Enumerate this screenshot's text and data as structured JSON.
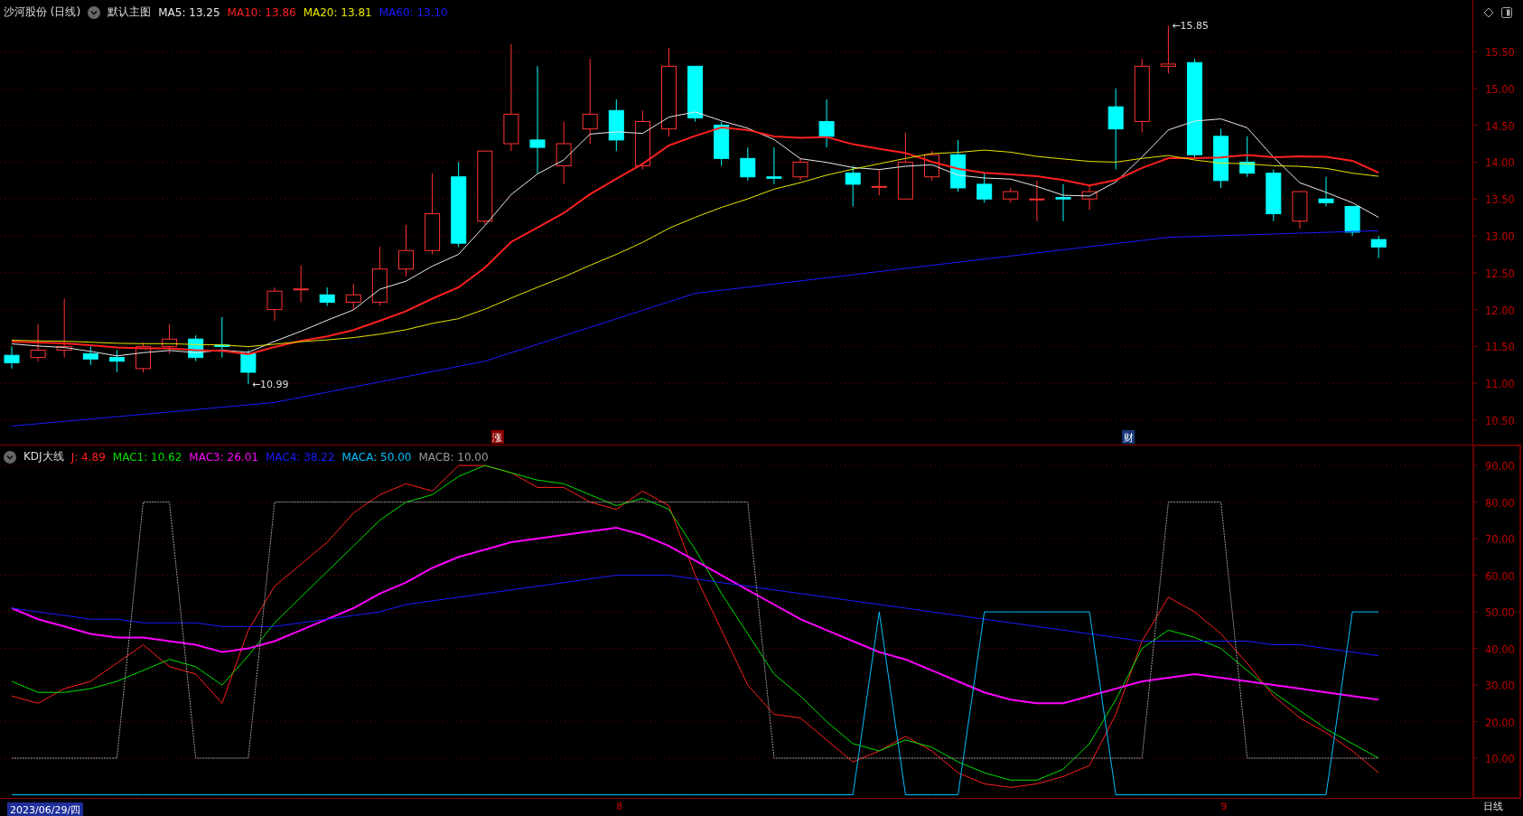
{
  "price_panel": {
    "title": "沙河股份 (日线)",
    "template": "默认主图",
    "legend": [
      {
        "label": "MA5: 13.25",
        "color": "#e8e8e8"
      },
      {
        "label": "MA10: 13.86",
        "color": "#ff2020"
      },
      {
        "label": "MA20: 13.81",
        "color": "#e6e600"
      },
      {
        "label": "MA60: 13.10",
        "color": "#1a1aff"
      }
    ],
    "annotations": [
      {
        "text": "←10.99"
      },
      {
        "text": "←15.85"
      }
    ],
    "markers": [
      {
        "text": "涨",
        "color": "#8b0000"
      },
      {
        "text": "财",
        "color": "#1a3a7a"
      }
    ],
    "yticks": [
      "15.50",
      "15.00",
      "14.50",
      "14.00",
      "13.50",
      "13.00",
      "12.50",
      "12.00",
      "11.50",
      "11.00",
      "10.50"
    ]
  },
  "indicator_panel": {
    "title": "KDJ大线",
    "legend": [
      {
        "value": "4.89"
      },
      {
        "value": "10.62"
      },
      {
        "value": "26.01"
      },
      {
        "value": "38.22"
      },
      {
        "value": "50.00"
      },
      {
        "value": "10.00"
      }
    ],
    "chart_data": {
      "type": "line",
      "grid": true,
      "ylim": [
        -1.1,
        95.7
      ],
      "yticks": [
        {
          "value": 90,
          "label": "90.00"
        },
        {
          "value": 80,
          "label": "80.00"
        },
        {
          "value": 70,
          "label": "70.00"
        },
        {
          "value": 60,
          "label": "60.00"
        },
        {
          "value": 50,
          "label": "50.00"
        },
        {
          "value": 40,
          "label": "40.00"
        },
        {
          "value": 30,
          "label": "30.00"
        },
        {
          "value": 20,
          "label": "20.00"
        },
        {
          "value": 10,
          "label": "10.00"
        }
      ],
      "series": [
        {
          "name": "J:",
          "color": "#ff2020",
          "values": [
            27,
            25,
            29,
            31,
            36,
            41,
            35,
            33,
            25,
            45,
            57,
            63,
            69,
            77,
            82,
            85,
            83,
            90,
            90,
            88,
            84,
            84,
            80,
            78,
            83,
            79,
            60,
            45,
            30,
            22,
            21,
            15,
            9,
            12,
            16,
            12,
            6,
            3,
            2,
            3,
            5,
            8,
            22,
            42,
            54,
            50,
            44,
            36,
            27,
            21,
            17,
            12,
            6
          ]
        },
        {
          "name": "MAC1:",
          "color": "#00e000",
          "values": [
            31,
            28,
            28,
            29,
            31,
            34,
            37,
            35,
            30,
            38,
            47,
            54,
            61,
            68,
            75,
            80,
            82,
            87,
            90,
            88,
            86,
            85,
            82,
            79,
            81,
            78,
            67,
            55,
            44,
            33,
            27,
            20,
            14,
            12,
            15,
            13,
            9,
            6,
            4,
            4,
            7,
            14,
            26,
            40,
            45,
            43,
            40,
            34,
            28,
            23,
            18,
            14,
            10
          ]
        },
        {
          "name": "MAC3:",
          "color": "#ff00ff",
          "values": [
            51,
            48,
            46,
            44,
            43,
            43,
            42,
            41,
            39,
            40,
            42,
            45,
            48,
            51,
            55,
            58,
            62,
            65,
            67,
            69,
            70,
            71,
            72,
            73,
            71,
            68,
            64,
            60,
            56,
            52,
            48,
            45,
            42,
            39,
            37,
            34,
            31,
            28,
            26,
            25,
            25,
            27,
            29,
            31,
            32,
            33,
            32,
            31,
            30,
            29,
            28,
            27,
            26
          ]
        },
        {
          "name": "MAC4:",
          "color": "#1a1aff",
          "values": [
            51,
            50,
            49,
            48,
            48,
            47,
            47,
            47,
            46,
            46,
            46,
            47,
            48,
            49,
            50,
            52,
            53,
            54,
            55,
            56,
            57,
            58,
            59,
            60,
            60,
            60,
            59,
            58,
            57,
            56,
            55,
            54,
            53,
            52,
            51,
            50,
            49,
            48,
            47,
            46,
            45,
            44,
            43,
            42,
            42,
            42,
            42,
            42,
            41,
            41,
            40,
            39,
            38
          ]
        },
        {
          "name": "MACA:",
          "color": "#00bfff",
          "values": [
            0,
            0,
            0,
            0,
            0,
            0,
            0,
            0,
            0,
            0,
            0,
            0,
            0,
            0,
            0,
            0,
            0,
            0,
            0,
            0,
            0,
            0,
            0,
            0,
            0,
            0,
            0,
            0,
            0,
            0,
            0,
            0,
            0,
            50,
            0,
            0,
            0,
            50,
            50,
            50,
            50,
            50,
            0,
            0,
            0,
            0,
            0,
            0,
            0,
            0,
            0,
            50,
            50
          ]
        },
        {
          "name": "MACB:",
          "color": "#9a9a9a",
          "line_style": "dashed",
          "values": [
            10,
            10,
            10,
            10,
            10,
            80,
            80,
            10,
            10,
            10,
            80,
            80,
            80,
            80,
            80,
            80,
            80,
            80,
            80,
            80,
            80,
            80,
            80,
            80,
            80,
            80,
            80,
            80,
            80,
            10,
            10,
            10,
            10,
            10,
            10,
            10,
            10,
            10,
            10,
            10,
            10,
            10,
            10,
            10,
            80,
            80,
            80,
            10,
            10,
            10,
            10,
            10,
            10
          ]
        }
      ]
    }
  },
  "date_bar": {
    "date": "2023/06/29/四",
    "months": [
      "8",
      "9"
    ],
    "period": "日线"
  }
}
